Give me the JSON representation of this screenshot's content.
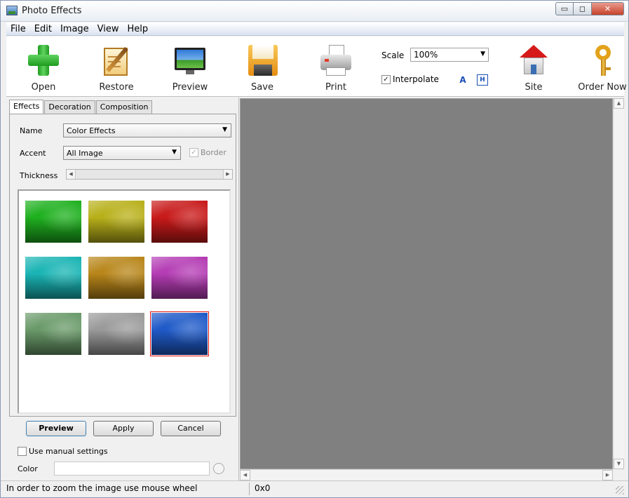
{
  "window": {
    "title": "Photo Effects",
    "min_glyph": "▭",
    "max_glyph": "◻",
    "close_glyph": "✕"
  },
  "menu": [
    "File",
    "Edit",
    "Image",
    "View",
    "Help"
  ],
  "toolbar": {
    "buttons": [
      {
        "label": "Open",
        "icon": "open-icon"
      },
      {
        "label": "Restore",
        "icon": "restore-icon"
      },
      {
        "label": "Preview",
        "icon": "preview-icon"
      },
      {
        "label": "Save",
        "icon": "save-icon"
      },
      {
        "label": "Print",
        "icon": "print-icon"
      },
      {
        "label": "Site",
        "icon": "site-icon"
      },
      {
        "label": "Order Now",
        "icon": "key-icon"
      }
    ],
    "scale_label": "Scale",
    "scale_value": "100%",
    "interpolate_label": "Interpolate",
    "interpolate_checked": "✓"
  },
  "tabs": [
    "Effects",
    "Decoration",
    "Composition"
  ],
  "effects": {
    "name_label": "Name",
    "name_value": "Color Effects",
    "accent_label": "Accent",
    "accent_value": "All Image",
    "border_label": "Border",
    "border_checked": "✓",
    "thickness_label": "Thickness",
    "thumbnails": [
      {
        "tint": "#1fb01f"
      },
      {
        "tint": "#b8b01a"
      },
      {
        "tint": "#c81a1a"
      },
      {
        "tint": "#1ab4b4"
      },
      {
        "tint": "#b8861a"
      },
      {
        "tint": "#b43cb4"
      },
      {
        "tint": "#6a9a6a"
      },
      {
        "tint": "#9a9a9a"
      },
      {
        "tint": "#1f5ac8",
        "selected": true
      }
    ]
  },
  "buttons": {
    "preview": "Preview",
    "apply": "Apply",
    "cancel": "Cancel"
  },
  "manual_settings_label": "Use manual settings",
  "color_label": "Color",
  "status": {
    "hint": "In order to zoom the image use mouse wheel",
    "size": "0x0"
  },
  "colors": {
    "canvas": "#808080",
    "selection": "#e01010"
  }
}
